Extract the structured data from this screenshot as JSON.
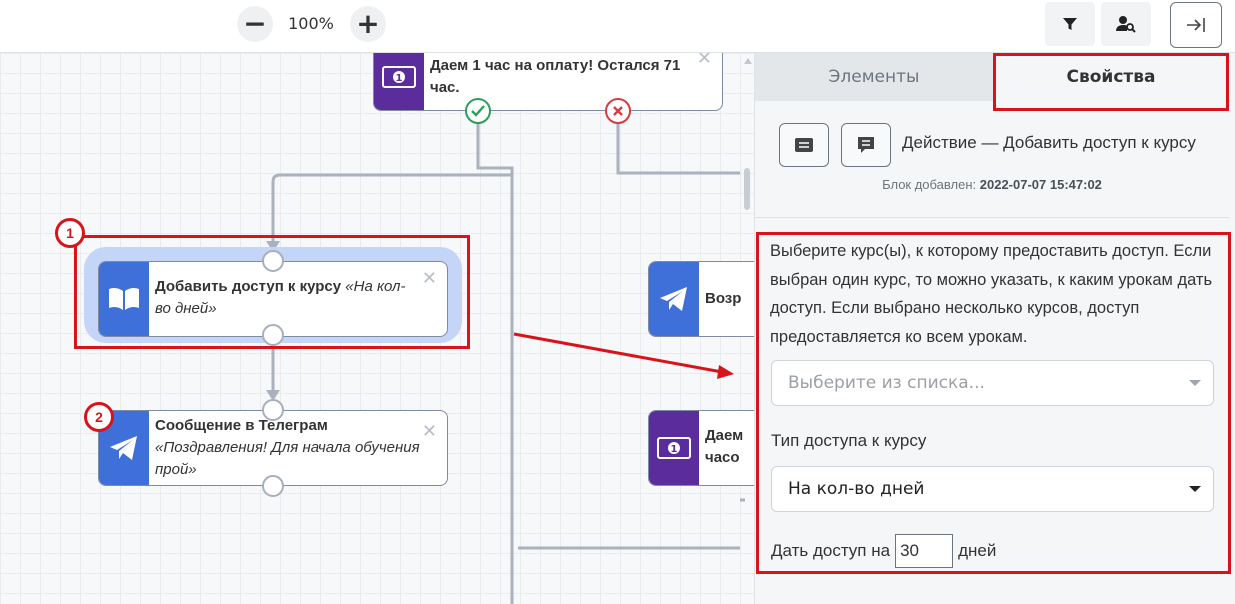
{
  "toolbar": {
    "zoom_out": "−",
    "zoom_level": "100%",
    "zoom_in": "+"
  },
  "nodes": {
    "payment_top": {
      "title": "Даем 1 час на оплату! Остался 71 час."
    },
    "add_access": {
      "title": "Добавить доступ к курсу",
      "subtitle": "«На кол-во дней»"
    },
    "telegram": {
      "title": "Сообщение в Телеграм",
      "subtitle": "«Поздравления! Для начала обучения прой»"
    },
    "right_telegram": {
      "title": "Возр"
    },
    "right_payment": {
      "line1": "Даем",
      "line2": "часо"
    }
  },
  "badges": {
    "one": "1",
    "two": "2"
  },
  "panel": {
    "tabs": {
      "elements": "Элементы",
      "properties": "Свойства"
    },
    "action_title": "Действие — Добавить доступ к курсу",
    "added_label": "Блок добавлен:",
    "added_value": "2022-07-07 15:47:02",
    "description": "Выберите курс(ы), к которому предоставить доступ. Если выбран один курс, то можно указать, к каким урокам дать доступ. Если выбрано несколько курсов, доступ предоставляется ко всем урокам.",
    "course_select_placeholder": "Выберите из списка...",
    "access_type_label": "Тип доступа к курсу",
    "access_type_value": "На кол-во дней",
    "give_access_prefix": "Дать доступ на",
    "days_value": "30",
    "days_suffix": "дней"
  },
  "colors": {
    "accent_red": "#d7141a",
    "action_blue": "#3f6fd8",
    "payment_purple": "#5b2d9c"
  }
}
